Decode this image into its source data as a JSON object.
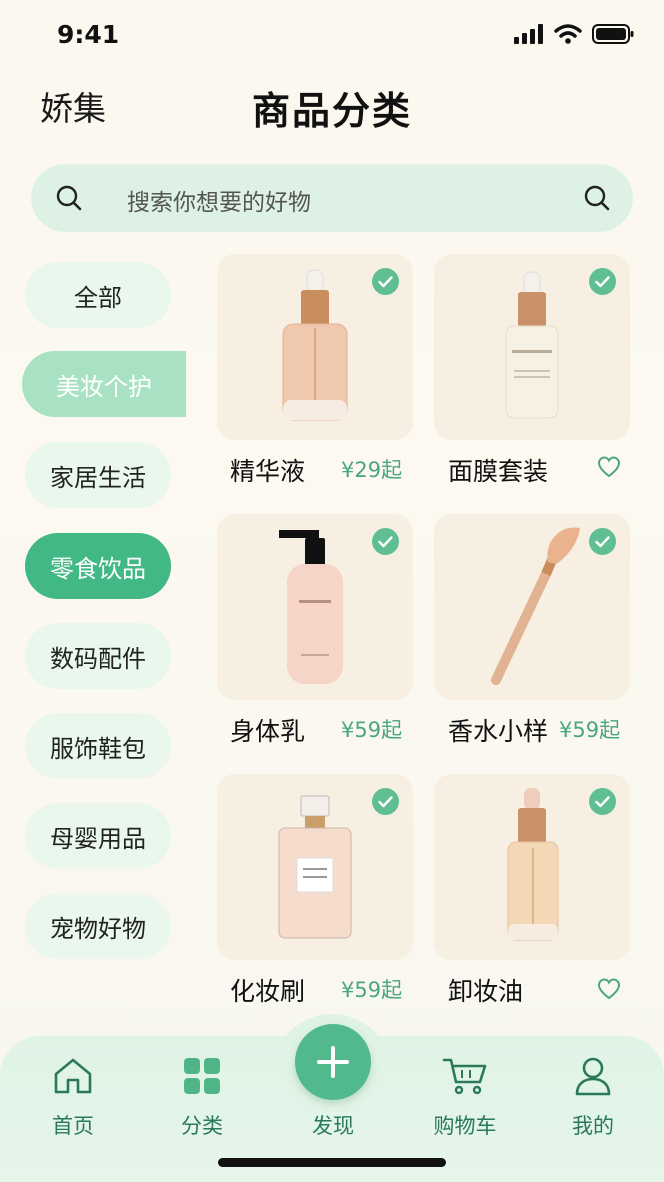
{
  "status": {
    "time": "9:41"
  },
  "header": {
    "brand": "娇集",
    "title": "商品分类"
  },
  "search": {
    "placeholder": "搜索你想要的好物"
  },
  "sidebar": {
    "items": [
      {
        "label": "全部"
      },
      {
        "label": "美妆个护"
      },
      {
        "label": "家居生活"
      },
      {
        "label": "零食饮品"
      },
      {
        "label": "数码配件"
      },
      {
        "label": "服饰鞋包"
      },
      {
        "label": "母婴用品"
      },
      {
        "label": "宠物好物"
      }
    ]
  },
  "products": [
    {
      "name": "精华液",
      "price": "¥29起"
    },
    {
      "name": "面膜套装",
      "price": ""
    },
    {
      "name": "身体乳",
      "price": "¥59起"
    },
    {
      "name": "香水小样",
      "price": "¥59起"
    },
    {
      "name": "化妆刷",
      "price": "¥59起"
    },
    {
      "name": "卸妆油",
      "price": ""
    }
  ],
  "bottom_nav": {
    "items": [
      {
        "label": "首页",
        "icon": "home-icon"
      },
      {
        "label": "分类",
        "icon": "grid-icon"
      },
      {
        "label": "发现",
        "icon": "plus-icon"
      },
      {
        "label": "购物车",
        "icon": "cart-icon"
      },
      {
        "label": "我的",
        "icon": "user-icon"
      }
    ]
  },
  "colors": {
    "accent": "#42b884",
    "soft_accent": "#a9e2c2",
    "price": "#4aa77c"
  }
}
